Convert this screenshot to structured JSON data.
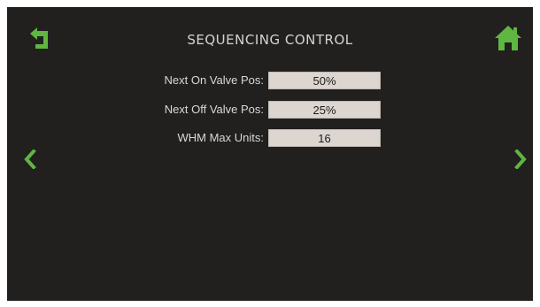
{
  "header": {
    "title": "SEQUENCING CONTROL",
    "back_icon": "back-return-icon",
    "home_icon": "home-icon"
  },
  "fields": [
    {
      "label": "Next On Valve Pos:",
      "value": "50%"
    },
    {
      "label": "Next Off Valve Pos:",
      "value": "25%"
    },
    {
      "label": "WHM Max Units:",
      "value": "16"
    }
  ],
  "nav": {
    "prev_icon": "chevron-left-icon",
    "next_icon": "chevron-right-icon"
  },
  "colors": {
    "background": "#221f1f",
    "accent_green": "#5fb640",
    "field_bg": "#ddd6d0",
    "text": "#d8d8d8"
  }
}
